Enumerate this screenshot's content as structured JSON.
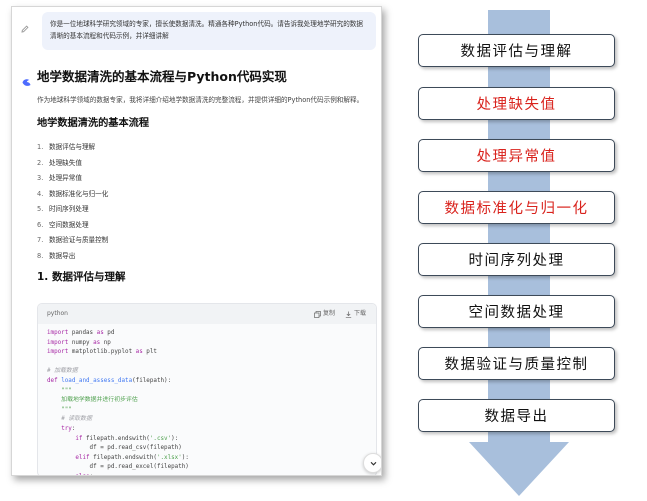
{
  "chat": {
    "user_prompt": "你是一位地球科学研究领域的专家，擅长使数据清洗。精通各种Python代码。请告诉我处理地学研究的数据清晰的基本流程和代码示例，并详细讲解",
    "title": "地学数据清洗的基本流程与Python代码实现",
    "intro": "作为地球科学领域的数据专家，我将详细介绍地学数据清洗的完整流程，并提供详细的Python代码示例和解释。",
    "section_title": "地学数据清洗的基本流程",
    "steps": [
      {
        "num": "1.",
        "label": "数据评估与理解"
      },
      {
        "num": "2.",
        "label": "处理缺失值"
      },
      {
        "num": "3.",
        "label": "处理异常值"
      },
      {
        "num": "4.",
        "label": "数据标准化与归一化"
      },
      {
        "num": "5.",
        "label": "时间序列处理"
      },
      {
        "num": "6.",
        "label": "空间数据处理"
      },
      {
        "num": "7.",
        "label": "数据验证与质量控制"
      },
      {
        "num": "8.",
        "label": "数据导出"
      }
    ],
    "subsection_title": "1. 数据评估与理解",
    "code": {
      "language": "python",
      "copy_label": "复制",
      "download_label": "下载"
    }
  },
  "flow": {
    "arrow_color": "#a8bfdc",
    "steps": [
      {
        "label": "数据评估与理解",
        "highlight": false
      },
      {
        "label": "处理缺失值",
        "highlight": true
      },
      {
        "label": "处理异常值",
        "highlight": true
      },
      {
        "label": "数据标准化与归一化",
        "highlight": true
      },
      {
        "label": "时间序列处理",
        "highlight": false
      },
      {
        "label": "空间数据处理",
        "highlight": false
      },
      {
        "label": "数据验证与质量控制",
        "highlight": false
      },
      {
        "label": "数据导出",
        "highlight": false
      }
    ]
  },
  "icons": [
    "edit-icon",
    "ai-logo-icon",
    "copy-icon",
    "download-icon",
    "chevron-down-icon"
  ]
}
